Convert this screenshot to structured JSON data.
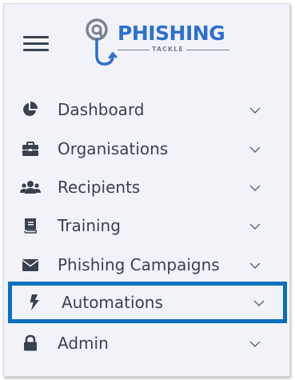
{
  "logo": {
    "text": "PHISHING",
    "subtext": "TACKLE"
  },
  "menu": {
    "items": [
      {
        "label": "Dashboard",
        "icon": "pie-chart-icon"
      },
      {
        "label": "Organisations",
        "icon": "briefcase-icon"
      },
      {
        "label": "Recipients",
        "icon": "users-icon"
      },
      {
        "label": "Training",
        "icon": "book-icon"
      },
      {
        "label": "Phishing Campaigns",
        "icon": "envelope-icon"
      },
      {
        "label": "Automations",
        "icon": "bolt-icon",
        "selected": true
      },
      {
        "label": "Admin",
        "icon": "lock-icon"
      }
    ]
  },
  "colors": {
    "brand": "#2f6fcb",
    "highlight_border": "#0a6fbd",
    "sidebar_bg": "#f1f3f9",
    "text": "#39414f"
  }
}
